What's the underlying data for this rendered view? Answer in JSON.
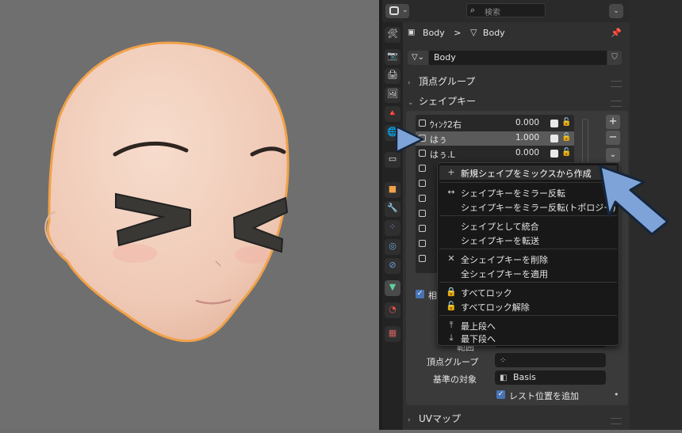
{
  "header": {
    "search_placeholder": "検索"
  },
  "breadcrumb": {
    "object": "Body",
    "separator": ">",
    "mesh": "Body"
  },
  "datablock": {
    "name": "Body"
  },
  "sections": {
    "vertex_groups": "頂点グループ",
    "shape_keys": "シェイプキー",
    "uv_maps": "UVマップ"
  },
  "shape_keys": [
    {
      "name": "ｳｨﾝｸ2右",
      "value": "0.000",
      "selected": false
    },
    {
      "name": "はぅ",
      "value": "1.000",
      "selected": true
    },
    {
      "name": "はぅ.L",
      "value": "0.000",
      "selected": false
    }
  ],
  "side_buttons": {
    "add": "+",
    "remove": "−",
    "specials": "⌄"
  },
  "relative": {
    "label": "相対"
  },
  "props": {
    "range_min_label": "範囲",
    "vertex_group_label": "頂点グループ",
    "relative_to_label": "基準の対象",
    "relative_to_value": "Basis",
    "add_rest_label": "レスト位置を追加"
  },
  "menu": {
    "new_from_mix": "新規シェイプをミックスから作成",
    "mirror": "シェイプキーをミラー反転",
    "mirror_topology": "シェイプキーをミラー反転(トポロジー)",
    "join_as_shape": "シェイプとして統合",
    "transfer": "シェイプキーを転送",
    "delete_all": "全シェイプキーを削除",
    "apply_all": "全シェイプキーを適用",
    "lock_all": "すべてロック",
    "unlock_all": "すべてロック解除",
    "move_top": "最上段へ",
    "move_bottom": "最下段へ"
  },
  "colors": {
    "accent_blue": "#7ea3d8",
    "checkbox_blue": "#4774b5",
    "face_outline": "#f0a14a"
  }
}
